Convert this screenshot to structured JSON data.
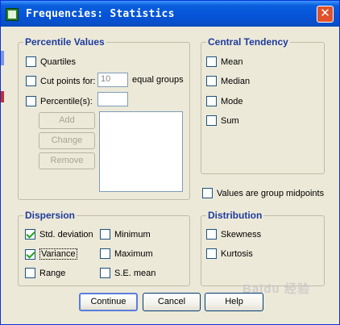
{
  "window": {
    "title": "Frequencies: Statistics",
    "close_glyph": "✕",
    "accent_color": "#0553d8"
  },
  "percentile_values": {
    "legend": "Percentile Values",
    "quartiles": {
      "label": "Quartiles",
      "checked": false
    },
    "cut_points": {
      "label": "Cut points for:",
      "checked": false,
      "value": "10",
      "suffix": "equal groups"
    },
    "percentiles": {
      "label": "Percentile(s):",
      "checked": false,
      "value": ""
    },
    "buttons": {
      "add": "Add",
      "change": "Change",
      "remove": "Remove"
    }
  },
  "central_tendency": {
    "legend": "Central Tendency",
    "mean": {
      "label": "Mean",
      "checked": false
    },
    "median": {
      "label": "Median",
      "checked": false
    },
    "mode": {
      "label": "Mode",
      "checked": false
    },
    "sum": {
      "label": "Sum",
      "checked": false
    }
  },
  "group_midpoints": {
    "label": "Values are group midpoints",
    "checked": false
  },
  "dispersion": {
    "legend": "Dispersion",
    "std_deviation": {
      "label": "Std. deviation",
      "checked": true
    },
    "variance": {
      "label": "Variance",
      "checked": true
    },
    "range": {
      "label": "Range",
      "checked": false
    },
    "minimum": {
      "label": "Minimum",
      "checked": false
    },
    "maximum": {
      "label": "Maximum",
      "checked": false
    },
    "se_mean": {
      "label": "S.E. mean",
      "checked": false
    }
  },
  "distribution": {
    "legend": "Distribution",
    "skewness": {
      "label": "Skewness",
      "checked": false
    },
    "kurtosis": {
      "label": "Kurtosis",
      "checked": false
    }
  },
  "actions": {
    "continue": "Continue",
    "cancel": "Cancel",
    "help": "Help"
  },
  "watermark": {
    "text": "Baidu 经验"
  }
}
